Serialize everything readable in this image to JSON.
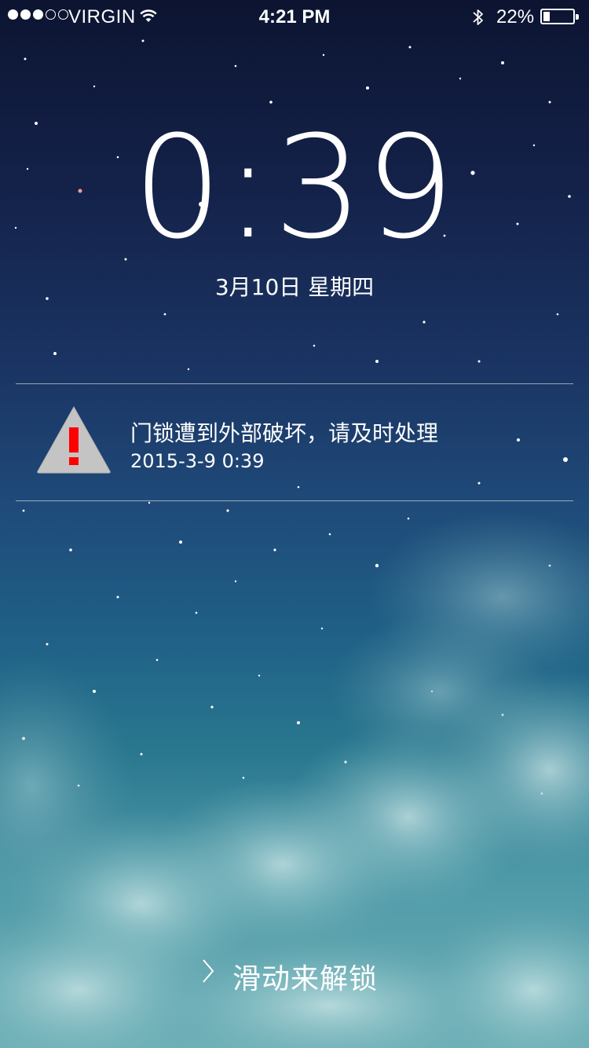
{
  "status_bar": {
    "carrier": "VIRGIN",
    "time": "4:21 PM",
    "battery": "22%",
    "battery_level": 0.22,
    "signal_bars_filled": 3,
    "signal_bars_total": 5,
    "icons": [
      "wifi-icon",
      "bluetooth-icon",
      "battery-icon"
    ]
  },
  "lock_screen": {
    "clock": "0:39",
    "date": "3月10日 星期四"
  },
  "notification": {
    "icon": "warning-icon",
    "title": "门锁遭到外部破坏，请及时处理",
    "timestamp": "2015-3-9  0:39",
    "icon_color": "#ff0000"
  },
  "unlock": {
    "label": "滑动来解锁",
    "icon": "chevron-right-icon"
  }
}
